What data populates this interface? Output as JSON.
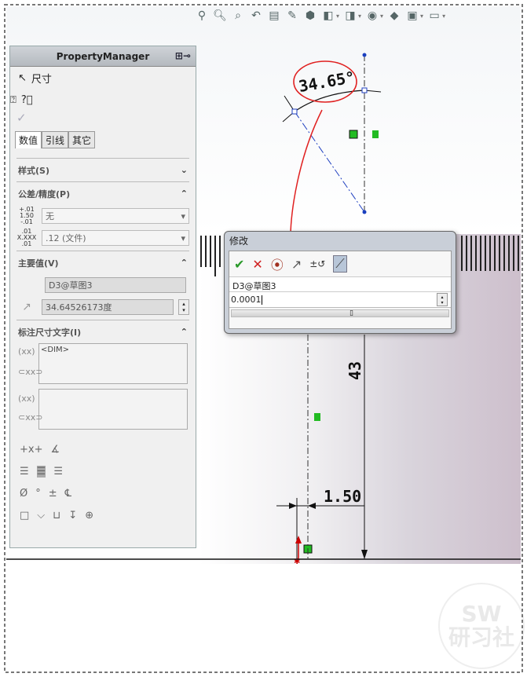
{
  "toolbar": {
    "icons": [
      "view-orientation-icon",
      "zoom-fit-icon",
      "zoom-area-icon",
      "previous-view-icon",
      "section-view-icon",
      "dynamic-annotation-icon",
      "display-style-icon",
      "hide-show-icon",
      "edit-appearance-icon",
      "apply-scene-icon",
      "view-settings-icon",
      "monitor-icon"
    ]
  },
  "pm": {
    "header": "PropertyManager",
    "title": "尺寸",
    "tabs": [
      "数值",
      "引线",
      "其它"
    ],
    "sections": {
      "style": "样式(S)",
      "tolerance": "公差/精度(P)",
      "primary": "主要值(V)",
      "text": "标注尺寸文字(I)"
    },
    "tol_icon": "1.50",
    "tol_icon_sup": "+.01",
    "tol_icon_sub": "-.01",
    "prec_icon": "X.XXX",
    "prec_icon_sup": ".01",
    "prec_icon_sub": ".01",
    "tolerance_value": "无",
    "precision_value": ".12 (文件)",
    "primary_name": "D3@草图3",
    "primary_value": "34.64526173度",
    "dim_text": "<DIM>"
  },
  "dialog": {
    "title": "修改",
    "name": "D3@草图3",
    "value": "0.0001"
  },
  "dims": {
    "angle": "34.65°",
    "vertical": "43",
    "horizontal": "1.50"
  },
  "watermark": {
    "top": "SW",
    "bottom": "研习社"
  },
  "colors": {
    "annotation": "#e02020",
    "sketch_blue": "#2040c0",
    "relation_green": "#22bb22"
  }
}
